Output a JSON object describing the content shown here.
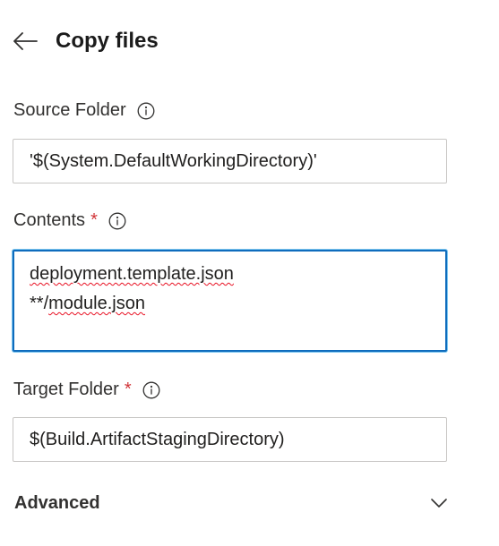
{
  "header": {
    "title": "Copy files",
    "back_icon": "arrow-left-icon"
  },
  "fields": {
    "source_folder": {
      "label": "Source Folder",
      "required": false,
      "value": "'$(System.DefaultWorkingDirectory)'"
    },
    "contents": {
      "label": "Contents",
      "required": true,
      "required_marker": "*",
      "lines": [
        "deployment.template.json",
        "**/",
        "module.json"
      ]
    },
    "target_folder": {
      "label": "Target Folder",
      "required": true,
      "required_marker": "*",
      "value": "$(Build.ArtifactStagingDirectory)"
    }
  },
  "advanced": {
    "label": "Advanced",
    "expanded": false,
    "icon": "chevron-down-icon"
  },
  "colors": {
    "focus_border": "#0f6cbd",
    "required": "#d13438",
    "spellcheck": "#e81123"
  }
}
